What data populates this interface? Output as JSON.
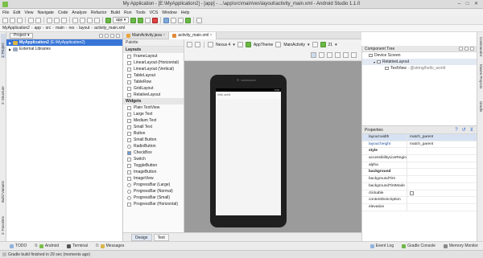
{
  "window": {
    "title": "My Application - [E:\\MyApplication2] - [app] - ...\\app\\src\\main\\res\\layout\\activity_main.xml - Android Studio 1.1.0",
    "controls": [
      "–",
      "□",
      "✕"
    ]
  },
  "menu": [
    "File",
    "Edit",
    "View",
    "Navigate",
    "Code",
    "Analyze",
    "Refactor",
    "Build",
    "Run",
    "Tools",
    "VCS",
    "Window",
    "Help"
  ],
  "toolbar": {
    "run_config": "app"
  },
  "breadcrumb": [
    "MyApplication2",
    "app",
    "src",
    "main",
    "res",
    "layout",
    "activity_main.xml"
  ],
  "project_panel": {
    "view_selector": "Project",
    "tree": [
      {
        "label": "MyApplication2",
        "path": "(E:\\MyApplication2)",
        "selected": true
      },
      {
        "label": "External Libraries",
        "path": "",
        "selected": false
      }
    ]
  },
  "editor_tabs": [
    {
      "label": "MainActivity.java",
      "active": false,
      "close": "×"
    },
    {
      "label": "activity_main.xml",
      "active": true,
      "close": "×"
    }
  ],
  "palette": {
    "header": "Palette",
    "categories": [
      {
        "name": "Layouts",
        "items": [
          "FrameLayout",
          "LinearLayout (Horizontal)",
          "LinearLayout (Vertical)",
          "TableLayout",
          "TableRow",
          "GridLayout",
          "RelativeLayout"
        ]
      },
      {
        "name": "Widgets",
        "items": [
          "Plain TextView",
          "Large Text",
          "Medium Text",
          "Small Text",
          "Button",
          "Small Button",
          "RadioButton",
          "CheckBox",
          "Switch",
          "ToggleButton",
          "ImageButton",
          "ImageView",
          "ProgressBar (Large)",
          "ProgressBar (Normal)",
          "ProgressBar (Small)",
          "ProgressBar (Horizontal)"
        ]
      }
    ]
  },
  "design_toolbar": {
    "device": "Nexus 4",
    "theme": "AppTheme",
    "activity": "MainActivity",
    "api": "21"
  },
  "preview": {
    "app_title": "hello world",
    "time": "5:00"
  },
  "bottom_editor_tabs": [
    {
      "label": "Design",
      "active": true
    },
    {
      "label": "Text",
      "active": false
    }
  ],
  "component_tree": {
    "header": "Component Tree",
    "nodes": [
      {
        "label": "Device Screen",
        "depth": 0
      },
      {
        "label": "RelativeLayout",
        "depth": 1
      },
      {
        "label": "TextView",
        "extra": "- @string/hello_world",
        "depth": 2
      }
    ]
  },
  "properties": {
    "header": "Properties",
    "rows": [
      {
        "name": "layout:width",
        "value": "match_parent",
        "style": "hl"
      },
      {
        "name": "layout:height",
        "value": "match_parent",
        "style": "blue"
      },
      {
        "name": "style",
        "value": "",
        "style": "bold"
      },
      {
        "name": "accessibilityLiveRegion",
        "value": "",
        "style": ""
      },
      {
        "name": "alpha",
        "value": "",
        "style": ""
      },
      {
        "name": "background",
        "value": "",
        "style": "bold"
      },
      {
        "name": "backgroundTint",
        "value": "",
        "style": ""
      },
      {
        "name": "backgroundTintMode",
        "value": "",
        "style": ""
      },
      {
        "name": "clickable",
        "value": "",
        "style": "checkbox"
      },
      {
        "name": "contentDescription",
        "value": "",
        "style": ""
      },
      {
        "name": "elevation",
        "value": "",
        "style": ""
      }
    ]
  },
  "side_tabs": {
    "left": [
      "1: Project",
      "2: Structure",
      "Build Variants",
      "2: Favorites"
    ],
    "right": [
      "Commander",
      "Maven Projects",
      "Gradle"
    ]
  },
  "bottom_tools": [
    {
      "label": "TODO",
      "num": ""
    },
    {
      "label": "Android",
      "num": "6:"
    },
    {
      "label": "Terminal",
      "num": ""
    },
    {
      "label": "Messages",
      "num": "0:"
    }
  ],
  "bottom_tools_right": [
    "Event Log",
    "Gradle Console",
    "Memory Monitor"
  ],
  "status": "Gradle build finished in 29 sec (moments ago)",
  "colors": {
    "selection": "#3875d7",
    "canvas": "#9b9b9b",
    "android_green": "#7bbf49"
  }
}
